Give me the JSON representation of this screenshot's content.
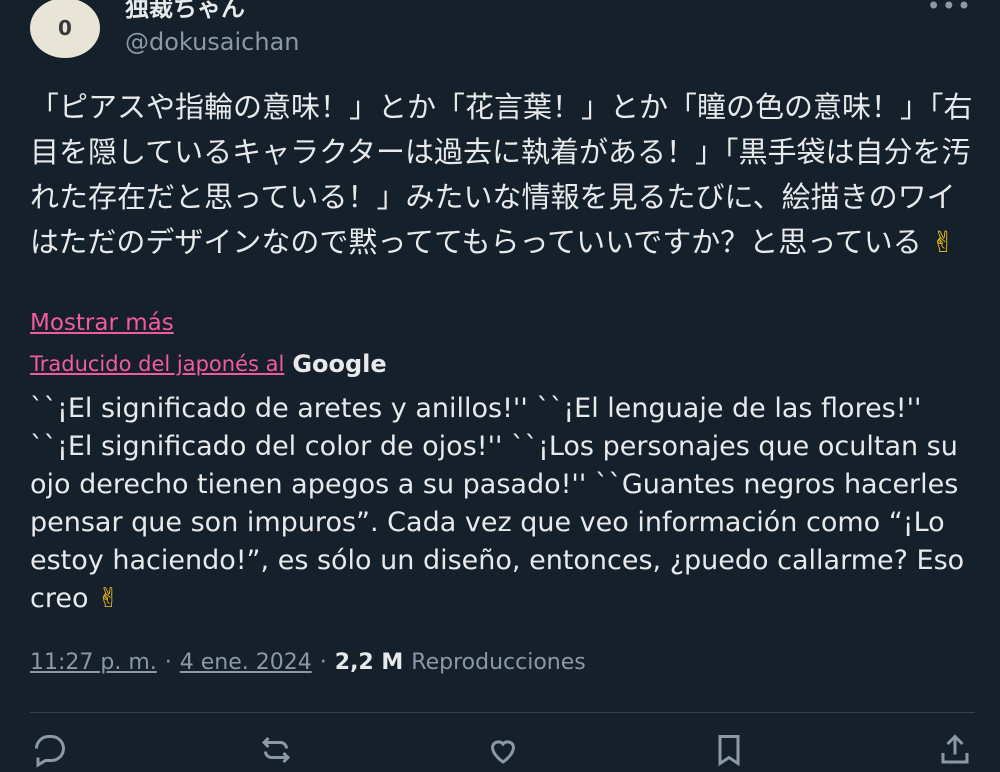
{
  "author": {
    "avatar_text": "0",
    "display_name": "独裁ちゃん",
    "handle": "@dokusaichan"
  },
  "menu_icon": "more-horizontal-icon",
  "tweet": {
    "original_text": "「ピアスや指輪の意味！」とか「花言葉！」とか「瞳の色の意味！」「右目を隠しているキャラクターは過去に執着がある！」「黒手袋は自分を汚れた存在だと思っている！」みたいな情報を見るたびに、絵描きのワイはただのデザインなので黙っててもらっていいですか？と思っている",
    "emoji": "✌",
    "show_more": "Mostrar más",
    "translated_from": "Traducido del japonés al",
    "translator": "Google",
    "translation_text": "``¡El significado de aretes y anillos!'' ``¡El lenguaje de las flores!'' ``¡El significado del color de ojos!'' ``¡Los personajes que ocultan su ojo derecho tienen apegos a su pasado!'' ``Guantes negros hacerles pensar que son impuros”. Cada vez que veo información como “¡Lo estoy haciendo!”, es sólo un diseño, entonces, ¿puedo callarme? Eso creo",
    "time": "11:27 p. m.",
    "separator": "·",
    "date": "4 ene. 2024",
    "views_count": "2,2 M",
    "views_label": "Reproducciones"
  },
  "colors": {
    "background": "#15202b",
    "text": "#e7e9ea",
    "muted": "#8b98a5",
    "link": "#f25ba0"
  }
}
